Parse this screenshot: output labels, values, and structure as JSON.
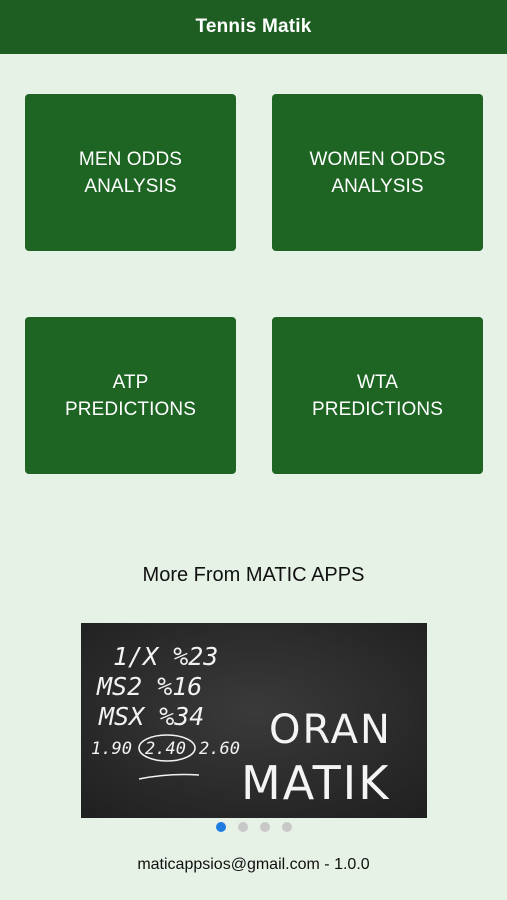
{
  "navbar": {
    "title": "Tennis Matik"
  },
  "menu": {
    "tiles": [
      {
        "label": "MEN ODDS\nANALYSIS"
      },
      {
        "label": "WOMEN ODDS\nANALYSIS"
      },
      {
        "label": "ATP\nPREDICTIONS"
      },
      {
        "label": "WTA\nPREDICTIONS"
      }
    ]
  },
  "more_apps": {
    "heading": "More From MATIC APPS",
    "banner": {
      "chalk_lines": [
        "1/X %23",
        "MS2 %16",
        "MSX %34",
        "1.90",
        "2.40",
        "2.60"
      ],
      "logo_text": [
        "ORAN",
        "MATIK"
      ]
    },
    "pager": {
      "count": 4,
      "active": 0
    }
  },
  "footer": {
    "text": "maticappsios@gmail.com - 1.0.0"
  },
  "colors": {
    "navbar": "#1e5e22",
    "tile": "#1e6524",
    "background": "#e6f2e6",
    "dot_active": "#1e7be0",
    "dot_inactive": "#c8c8c8"
  }
}
